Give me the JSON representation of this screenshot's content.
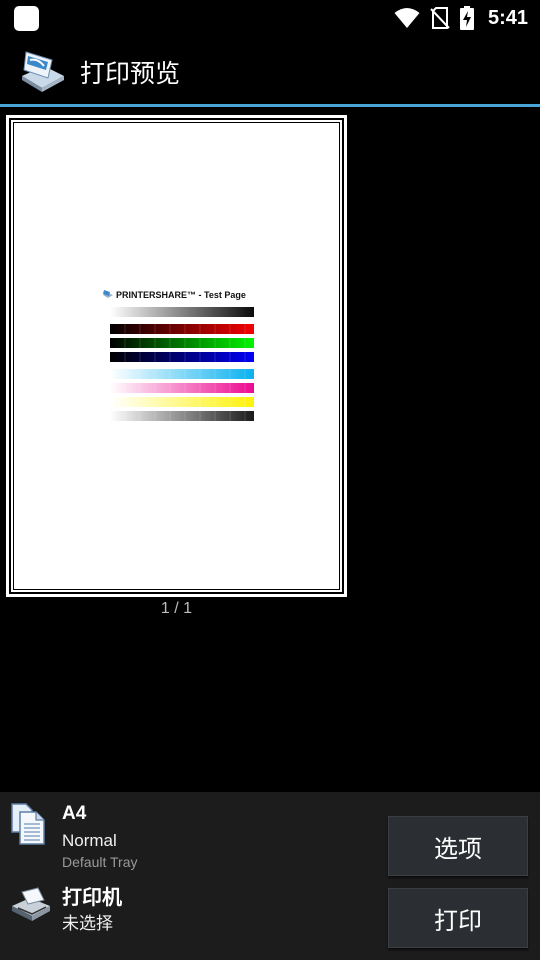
{
  "status_bar": {
    "time": "5:41",
    "icons": [
      "wifi-icon",
      "no-sim-icon",
      "battery-charging-icon"
    ]
  },
  "app_bar": {
    "title": "打印预览",
    "logo_icon": "printershare-logo-icon",
    "accent_color": "#4aa6d6"
  },
  "preview": {
    "test_page_title": "PRINTERSHARE™ - Test Page",
    "page_counter": "1 / 1"
  },
  "bottom": {
    "paper_size": "A4",
    "quality": "Normal",
    "tray": "Default Tray",
    "printer_label": "打印机",
    "printer_value": "未选择",
    "options_button": "选项",
    "print_button": "打印",
    "paper_icon": "paper-settings-icon",
    "printer_icon": "printer-icon"
  }
}
